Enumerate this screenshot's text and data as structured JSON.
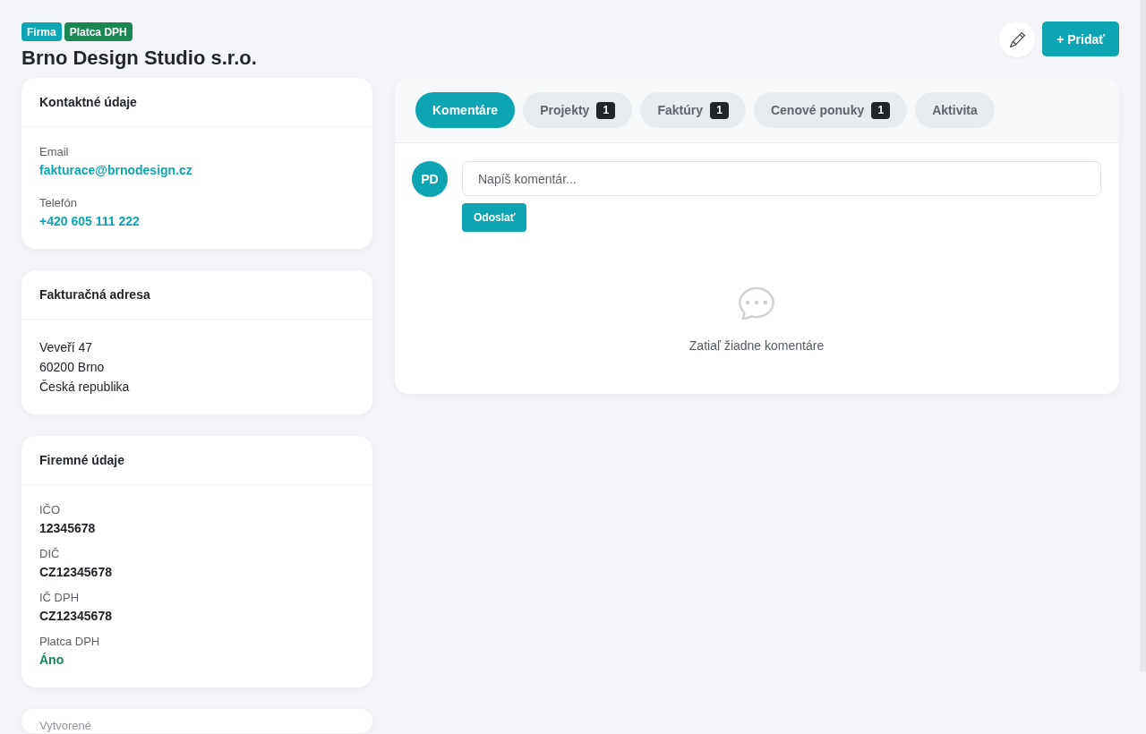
{
  "header": {
    "badges": [
      {
        "label": "Firma",
        "color": "#0fa5b3"
      },
      {
        "label": "Platca DPH",
        "color": "#1a8754"
      }
    ],
    "title": "Brno Design Studio s.r.o.",
    "add_button": "+ Pridať"
  },
  "sidebar": {
    "cards": [
      {
        "kind": "contact",
        "title": "Kontaktné údaje",
        "fields": [
          {
            "label": "Email",
            "value": "fakturace@brnodesign.cz",
            "kind": "link"
          },
          {
            "label": "Telefón",
            "value": "+420 605 111 222",
            "kind": "link"
          }
        ]
      },
      {
        "kind": "address",
        "title": "Fakturačná adresa",
        "lines": [
          "Veveří 47",
          "60200 Brno",
          "Česká republika"
        ]
      },
      {
        "kind": "company",
        "title": "Firemné údaje",
        "fields": [
          {
            "label": "IČO",
            "value": "12345678",
            "kind": "plain"
          },
          {
            "label": "DIČ",
            "value": "CZ12345678",
            "kind": "plain"
          },
          {
            "label": "IČ DPH",
            "value": "CZ12345678",
            "kind": "plain"
          },
          {
            "label": "Platca DPH",
            "value": "Áno",
            "kind": "success"
          }
        ]
      },
      {
        "kind": "faded",
        "label": "Vytvorené"
      }
    ]
  },
  "main": {
    "tabs": [
      {
        "label": "Komentáre",
        "selected": true
      },
      {
        "label": "Projekty",
        "count": "1",
        "selected": false
      },
      {
        "label": "Faktúry",
        "count": "1",
        "selected": false
      },
      {
        "label": "Cenové ponuky",
        "count": "1",
        "selected": false
      },
      {
        "label": "Aktivita",
        "selected": false
      }
    ],
    "composer": {
      "avatar": "PD",
      "placeholder": "Napíš komentár...",
      "submit": "Odoslať"
    },
    "empty_state": {
      "text": "Zatiaľ žiadne komentáre"
    }
  }
}
